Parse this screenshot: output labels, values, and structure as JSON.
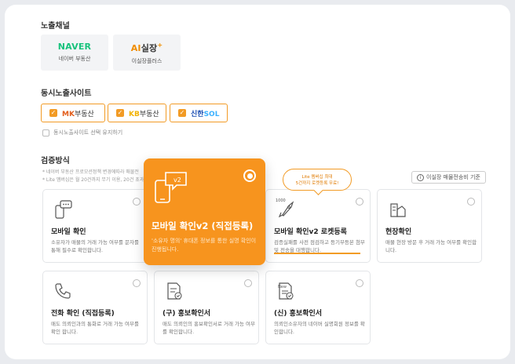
{
  "channels_section": {
    "title": "노출채널",
    "items": [
      {
        "logo": "NAVER",
        "sub": "네이버 부동산"
      },
      {
        "logo_prefix": "AI",
        "logo_rest": "실장",
        "logo_plus": "+",
        "sub": "이실장플러스"
      }
    ]
  },
  "simultaneous_section": {
    "title": "동시노출사이트",
    "sites": [
      {
        "brand": "MK",
        "rest": "부동산",
        "checked": true
      },
      {
        "brand": "KB",
        "rest": "부동산",
        "checked": true
      },
      {
        "brand": "신한",
        "rest": "SOL",
        "checked": true
      }
    ],
    "keep_label": "동시노출사이트 선택 유지하기"
  },
  "verification_section": {
    "title": "검증방식",
    "notes": [
      "* 네이버 부동산 프로모션정책 변경에따라 매물전",
      "* Lite 멤버십은 월 20건까지 무기 이용, 20건 초과"
    ],
    "reference_button": "이실장 매물전송비 기준",
    "tooltip_line1": "Lite 멤버십 최대",
    "tooltip_line2": "5건까지 로켓등록 무료!",
    "featured": {
      "icon_badge": "v2",
      "title": "모바일 확인v2 (직접등록)",
      "desc": "'소유자 명의' 휴대폰 정보를 통한 실명 확인이 진행됩니다."
    },
    "options": [
      {
        "title": "모바일 확인",
        "desc": "소유자가 매물의 거래 가능 여부를 문자를 통해 필수로 확인합니다."
      },
      {
        "title": "모바일 확인v2 로켓등록",
        "badge": "1000",
        "desc": "검증실패를 사전 점검하고 등기부등본 첨부 및 전송을 대행합니다."
      },
      {
        "title": "현장확인",
        "desc": "매물 현장 방문 후 거래 가능 여부를 확인합니다."
      },
      {
        "title": "전화 확인 (직접등록)",
        "desc": "매도 의뢰인과의 통화로 거래 가능 여부를 확인 합니다."
      },
      {
        "title": "(구) 홍보확인서",
        "desc": "매도 의뢰인의 홍보확인서로 거래 가능 여부를 확인합니다."
      },
      {
        "title": "(신) 홍보확인서",
        "badge": "New",
        "desc": "의뢰인소유자의 네이버 실명회원 정보를 확인합니다."
      }
    ]
  },
  "colors": {
    "accent": "#f7941e",
    "naver": "#19c37d"
  }
}
